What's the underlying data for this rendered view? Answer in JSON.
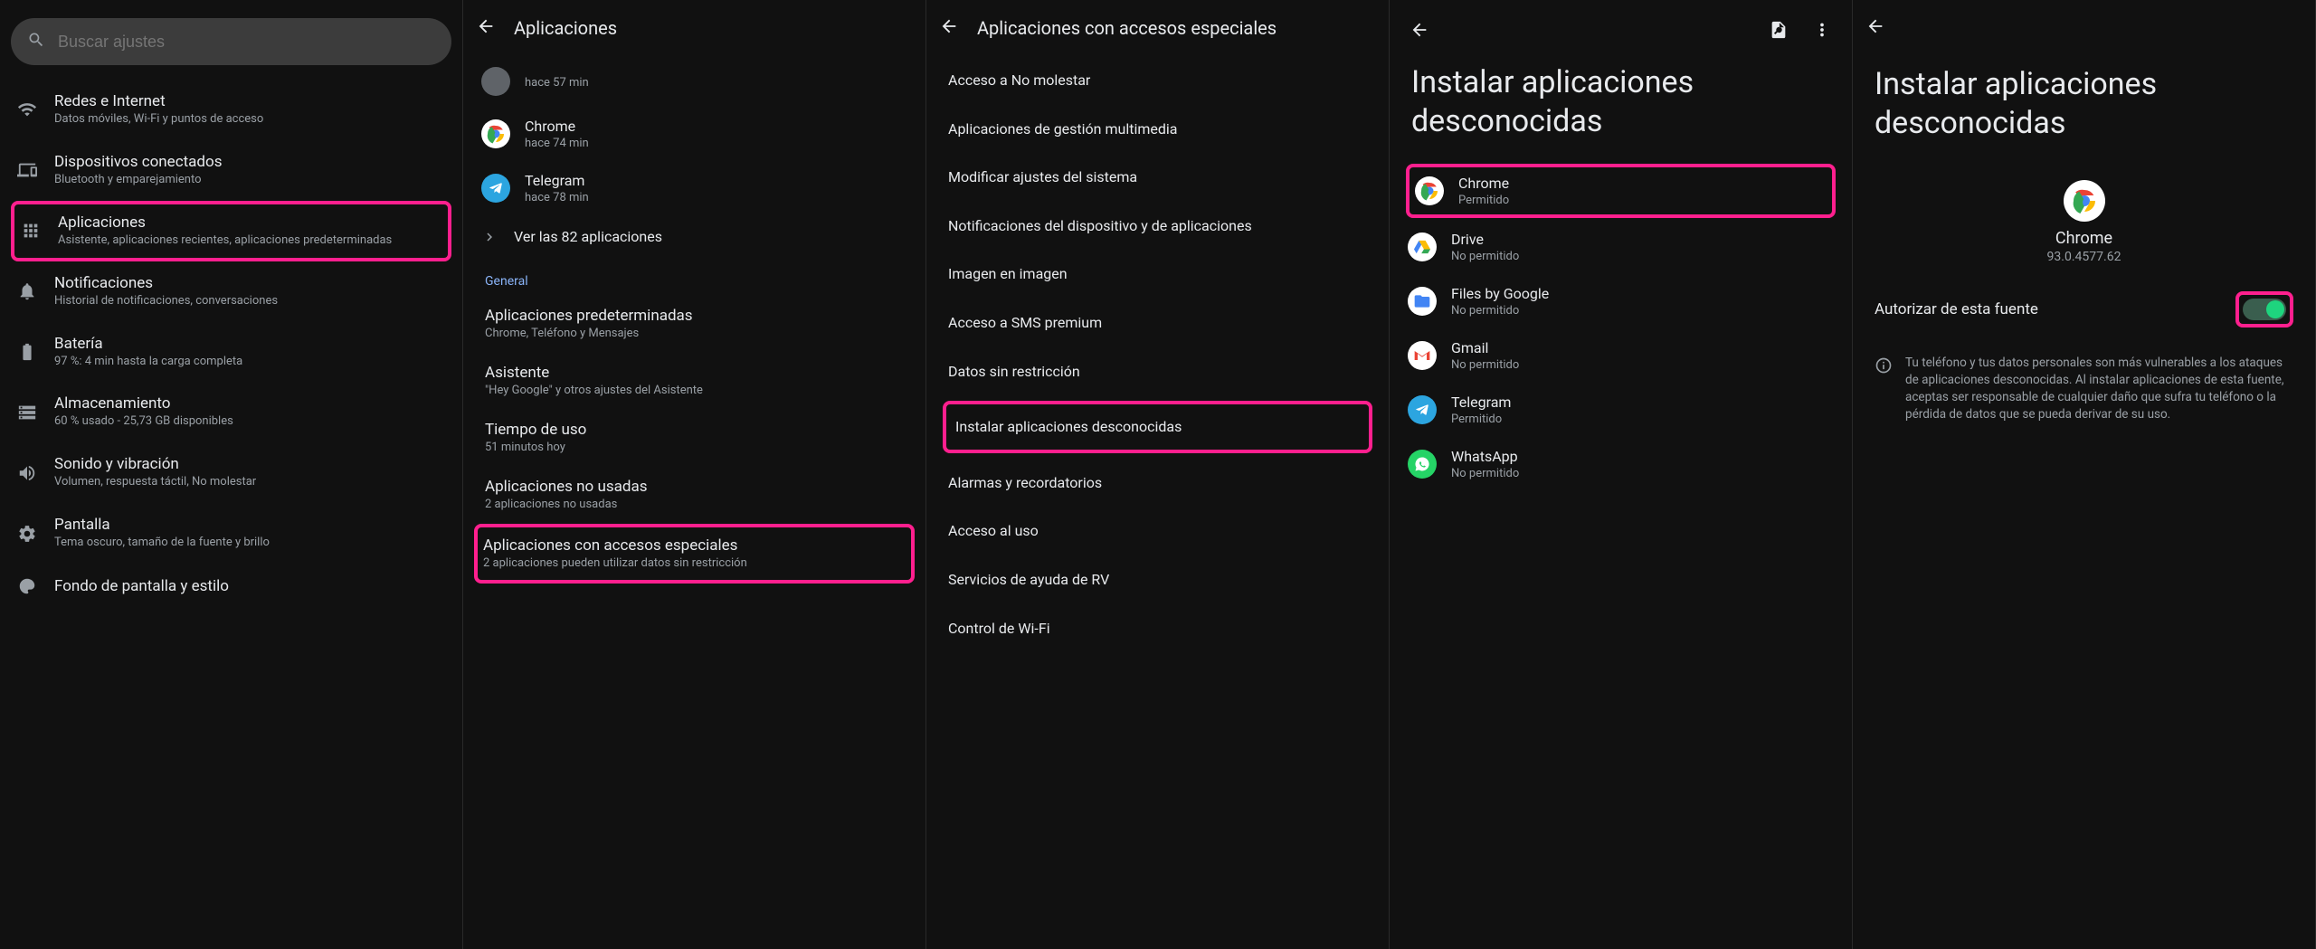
{
  "panel1": {
    "search_placeholder": "Buscar ajustes",
    "items": [
      {
        "title": "Redes e Internet",
        "sub": "Datos móviles, Wi-Fi y puntos de acceso"
      },
      {
        "title": "Dispositivos conectados",
        "sub": "Bluetooth y emparejamiento"
      },
      {
        "title": "Aplicaciones",
        "sub": "Asistente, aplicaciones recientes, aplicaciones predeterminadas"
      },
      {
        "title": "Notificaciones",
        "sub": "Historial de notificaciones, conversaciones"
      },
      {
        "title": "Batería",
        "sub": "97 %: 4 min hasta la carga completa"
      },
      {
        "title": "Almacenamiento",
        "sub": "60 % usado - 25,73 GB disponibles"
      },
      {
        "title": "Sonido y vibración",
        "sub": "Volumen, respuesta táctil, No molestar"
      },
      {
        "title": "Pantalla",
        "sub": "Tema oscuro, tamaño de la fuente y brillo"
      },
      {
        "title": "Fondo de pantalla y estilo",
        "sub": ""
      }
    ]
  },
  "panel2": {
    "header": "Aplicaciones",
    "recent": [
      {
        "name": "",
        "sub": "hace 57 min",
        "icon_type": "generic"
      },
      {
        "name": "Chrome",
        "sub": "hace 74 min",
        "icon_type": "chrome"
      },
      {
        "name": "Telegram",
        "sub": "hace 78 min",
        "icon_type": "telegram"
      }
    ],
    "see_all": "Ver las 82 aplicaciones",
    "section": "General",
    "general": [
      {
        "title": "Aplicaciones predeterminadas",
        "sub": "Chrome, Teléfono y Mensajes"
      },
      {
        "title": "Asistente",
        "sub": "\"Hey Google\" y otros ajustes del Asistente"
      },
      {
        "title": "Tiempo de uso",
        "sub": "51 minutos hoy"
      },
      {
        "title": "Aplicaciones no usadas",
        "sub": "2 aplicaciones no usadas"
      },
      {
        "title": "Aplicaciones con accesos especiales",
        "sub": "2 aplicaciones pueden utilizar datos sin restricción"
      }
    ]
  },
  "panel3": {
    "header": "Aplicaciones con accesos especiales",
    "items": [
      "Acceso a No molestar",
      "Aplicaciones de gestión multimedia",
      "Modificar ajustes del sistema",
      "Notificaciones del dispositivo y de aplicaciones",
      "Imagen en imagen",
      "Acceso a SMS premium",
      "Datos sin restricción",
      "Instalar aplicaciones desconocidas",
      "Alarmas y recordatorios",
      "Acceso al uso",
      "Servicios de ayuda de RV",
      "Control de Wi-Fi"
    ]
  },
  "panel4": {
    "title": "Instalar aplicaciones desconocidas",
    "apps": [
      {
        "name": "Chrome",
        "sub": "Permitido",
        "icon_type": "chrome"
      },
      {
        "name": "Drive",
        "sub": "No permitido",
        "icon_type": "drive"
      },
      {
        "name": "Files by Google",
        "sub": "No permitido",
        "icon_type": "files"
      },
      {
        "name": "Gmail",
        "sub": "No permitido",
        "icon_type": "gmail"
      },
      {
        "name": "Telegram",
        "sub": "Permitido",
        "icon_type": "telegram"
      },
      {
        "name": "WhatsApp",
        "sub": "No permitido",
        "icon_type": "whatsapp"
      }
    ]
  },
  "panel5": {
    "title": "Instalar aplicaciones desconocidas",
    "app_name": "Chrome",
    "app_version": "93.0.4577.62",
    "toggle_label": "Autorizar de esta fuente",
    "info_text": "Tu teléfono y tus datos personales son más vulnerables a los ataques de aplicaciones desconocidas. Al instalar aplicaciones de esta fuente, aceptas ser responsable de cualquier daño que sufra tu teléfono o la pérdida de datos que se pueda derivar de su uso."
  }
}
